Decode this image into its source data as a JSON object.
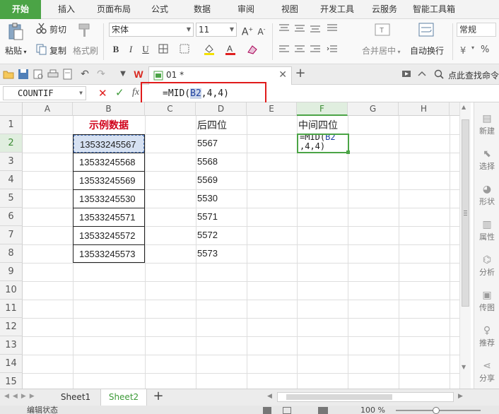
{
  "ribbon": {
    "tabs": [
      "开始",
      "插入",
      "页面布局",
      "公式",
      "数据",
      "审阅",
      "视图",
      "开发工具",
      "云服务",
      "智能工具箱"
    ],
    "active_tab": "开始"
  },
  "toolbar": {
    "paste_label": "粘贴",
    "cut_label": "剪切",
    "copy_label": "复制",
    "format_painter_label": "格式刷",
    "font_name": "宋体",
    "font_size": "11",
    "bold": "B",
    "italic": "I",
    "underline": "U",
    "merge_label": "合并居中",
    "wrap_label": "自动换行",
    "number_format": "常规",
    "percent": "%"
  },
  "docbar": {
    "doc_tab_title": "01 *",
    "search_label": "点此查找命令"
  },
  "formula_bar": {
    "name_box": "COUNTIF",
    "formula_prefix": "=MID(",
    "formula_ref": "B2",
    "formula_suffix": ",4,4)"
  },
  "grid": {
    "columns": [
      "A",
      "B",
      "C",
      "D",
      "E",
      "F",
      "G",
      "H"
    ],
    "selected_column": "F",
    "rows": [
      "1",
      "2",
      "3",
      "4",
      "5",
      "6",
      "7",
      "8",
      "9",
      "10",
      "11",
      "12",
      "13",
      "14",
      "15"
    ],
    "selected_row": "2",
    "header_b": "示例数据",
    "header_d": "后四位",
    "header_f": "中间四位",
    "col_b": [
      "13533245567",
      "13533245568",
      "13533245569",
      "13533245530",
      "13533245571",
      "13533245572",
      "13533245573"
    ],
    "col_d": [
      "5567",
      "5568",
      "5569",
      "5530",
      "5571",
      "5572",
      "5573"
    ],
    "f2_line1_prefix": "=MID(",
    "f2_line1_ref": "B2",
    "f2_line2": ",4,4)"
  },
  "sidebar": {
    "items": [
      "新建",
      "选择",
      "形状",
      "属性",
      "分析",
      "传图",
      "推荐",
      "分享"
    ]
  },
  "sheets": {
    "tabs": [
      "Sheet1",
      "Sheet2"
    ],
    "active": "Sheet2"
  },
  "status": {
    "mode": "编辑状态",
    "zoom": "100 %"
  },
  "colors": {
    "accent": "#4ba446",
    "highlight_red": "#e01b1b",
    "header_text_red": "#d0021b"
  }
}
